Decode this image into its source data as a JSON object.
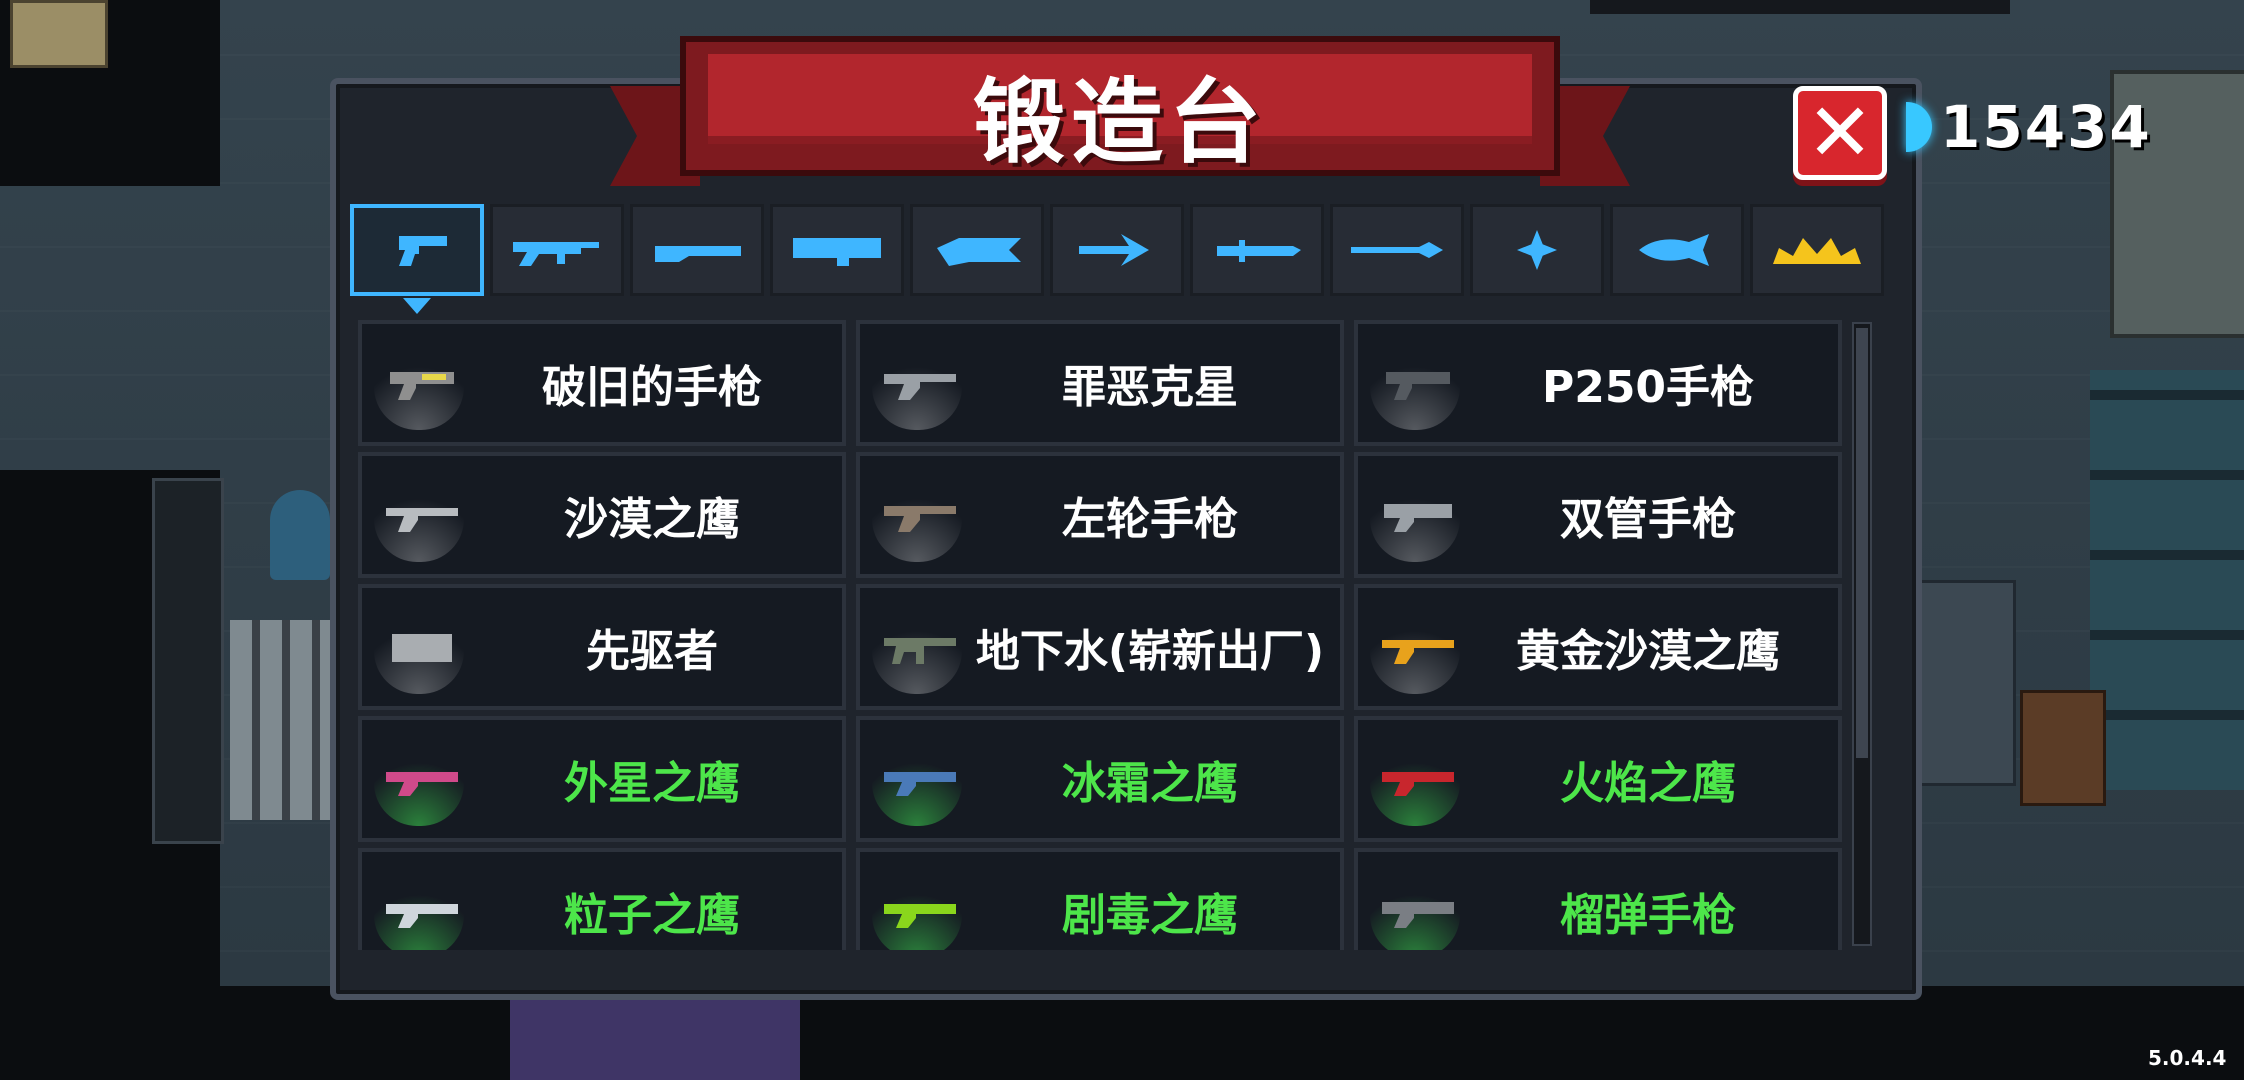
{
  "forge": {
    "title": "锻造台",
    "close_label": "✕",
    "currency": {
      "value": "15434",
      "icon": "gem-icon",
      "color": "#38c8ff"
    },
    "tabs": [
      {
        "name": "pistol",
        "icon": "pistol-icon",
        "active": true
      },
      {
        "name": "rifle",
        "icon": "rifle-icon",
        "active": false
      },
      {
        "name": "shotgun",
        "icon": "shotgun-icon",
        "active": false
      },
      {
        "name": "launcher",
        "icon": "launcher-icon",
        "active": false
      },
      {
        "name": "laser",
        "icon": "laser-gun-icon",
        "active": false
      },
      {
        "name": "bow",
        "icon": "bow-icon",
        "active": false
      },
      {
        "name": "sword",
        "icon": "sword-icon",
        "active": false
      },
      {
        "name": "spear",
        "icon": "spear-icon",
        "active": false
      },
      {
        "name": "shuriken",
        "icon": "shuriken-icon",
        "active": false
      },
      {
        "name": "fish",
        "icon": "fish-icon",
        "active": false
      },
      {
        "name": "special",
        "icon": "crown-icon",
        "active": false
      }
    ],
    "items": [
      {
        "name": "破旧的手枪",
        "rarity": "white"
      },
      {
        "name": "罪恶克星",
        "rarity": "white"
      },
      {
        "name": "P250手枪",
        "rarity": "white"
      },
      {
        "name": "沙漠之鹰",
        "rarity": "white"
      },
      {
        "name": "左轮手枪",
        "rarity": "white"
      },
      {
        "name": "双管手枪",
        "rarity": "white"
      },
      {
        "name": "先驱者",
        "rarity": "white"
      },
      {
        "name": "地下水(崭新出厂)",
        "rarity": "white"
      },
      {
        "name": "黄金沙漠之鹰",
        "rarity": "white"
      },
      {
        "name": "外星之鹰",
        "rarity": "green"
      },
      {
        "name": "冰霜之鹰",
        "rarity": "green"
      },
      {
        "name": "火焰之鹰",
        "rarity": "green"
      },
      {
        "name": "粒子之鹰",
        "rarity": "green"
      },
      {
        "name": "剧毒之鹰",
        "rarity": "green"
      },
      {
        "name": "榴弹手枪",
        "rarity": "green"
      }
    ],
    "colors": {
      "tab_icon": "#3fb6ff",
      "special_icon": "#f5c41c",
      "green_text": "#4de64a",
      "banner": "#b2262d"
    }
  },
  "version": "5.0.4.4"
}
